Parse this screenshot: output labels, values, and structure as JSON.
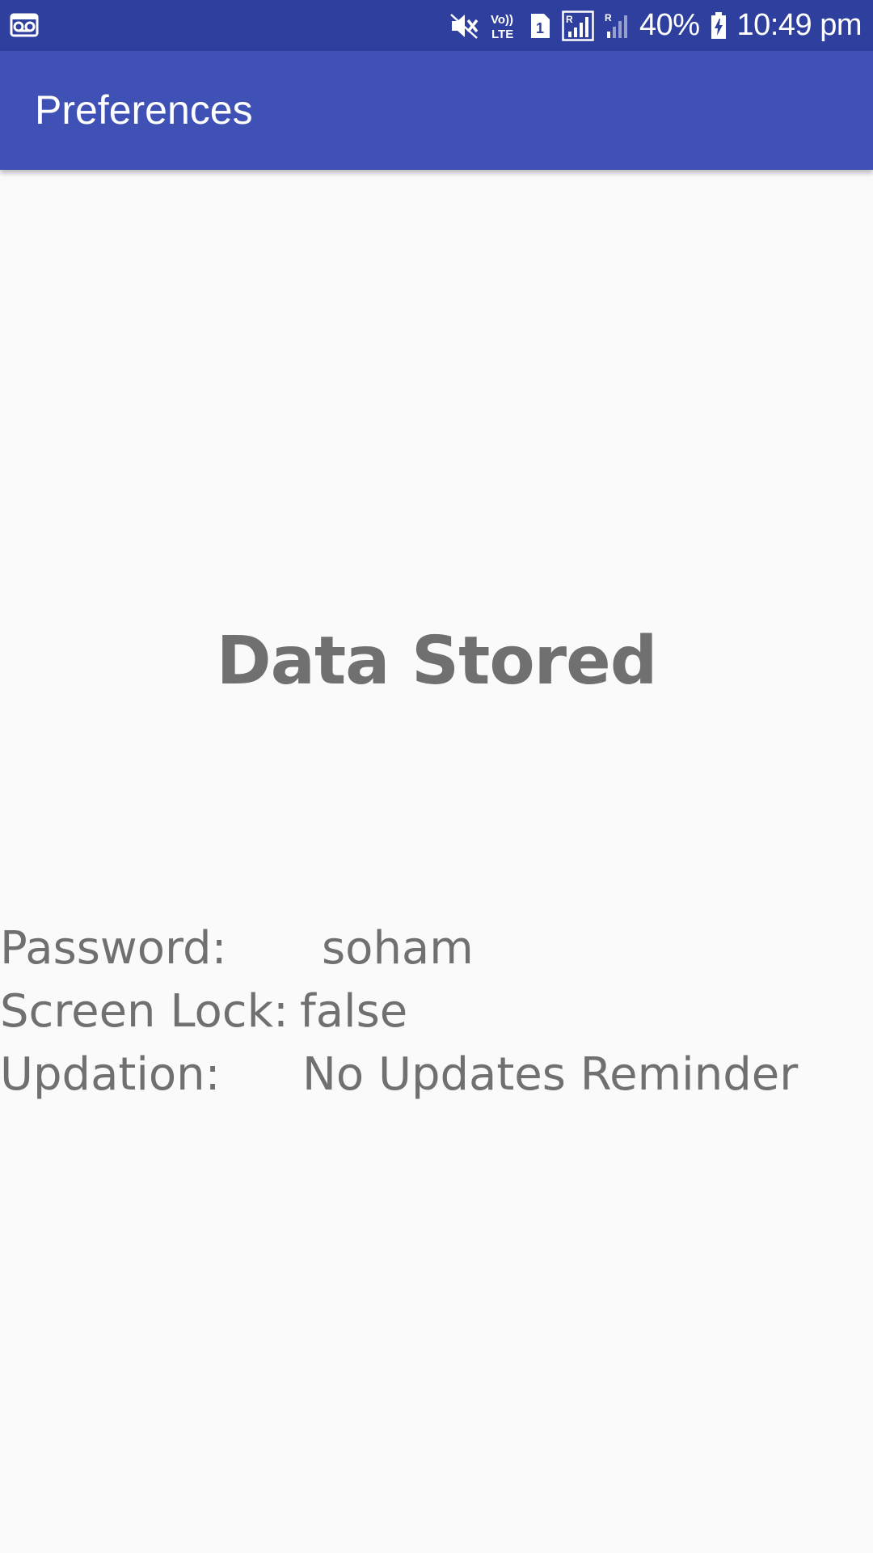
{
  "status_bar": {
    "battery_percent": "40%",
    "time": "10:49 pm",
    "icons": [
      "voicemail-icon",
      "mute-icon",
      "volte-icon",
      "sim-1-icon",
      "signal-roaming-icon",
      "signal-roaming-icon",
      "battery-charging-icon"
    ],
    "volte_text": "Vo)) LTE",
    "sim_label": "1"
  },
  "app_bar": {
    "title": "Preferences",
    "color": "#3f51b5",
    "status_color": "#2f3f9e"
  },
  "main": {
    "heading": "Data Stored",
    "rows": [
      {
        "label": "Password:",
        "value": "soham"
      },
      {
        "label": "Screen Lock:",
        "value": "false"
      },
      {
        "label": "Updation:",
        "value": "No Updates Reminder"
      }
    ]
  }
}
